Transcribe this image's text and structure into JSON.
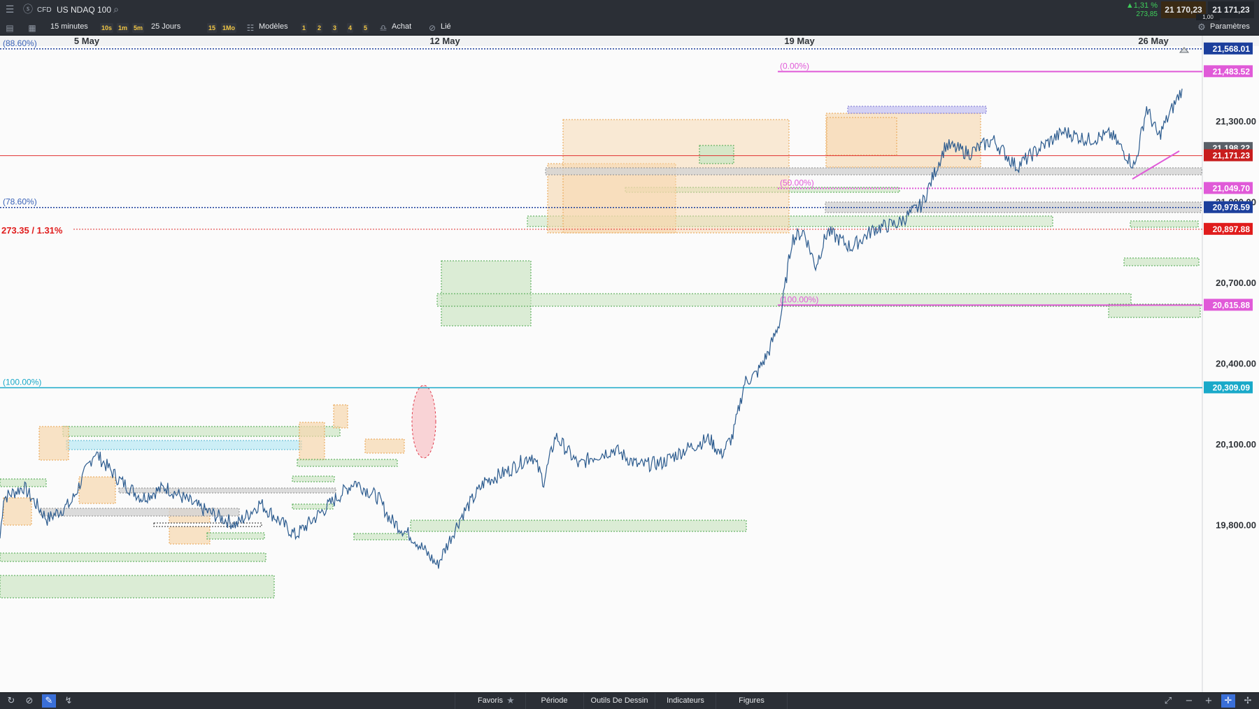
{
  "header": {
    "instrument_type": "CFD",
    "instrument_name": "US NDAQ 100",
    "change_pct": "▲1,31 %",
    "change_abs": "273,85",
    "sell_price": "21 170,23",
    "buy_price": "21 171,23",
    "spread": "1,00"
  },
  "toolbar": {
    "timeframe": "15 minutes",
    "quick_timeframes": [
      "10s",
      "1m",
      "5m"
    ],
    "period": "25 Jours",
    "quick_periods": [
      "15",
      "1Mo"
    ],
    "templates_label": "Modèles",
    "layouts": [
      "1",
      "2",
      "3",
      "4",
      "5"
    ],
    "buy_label": "Achat",
    "linked_label": "Lié",
    "settings_label": "Paramètres"
  },
  "chart_data": {
    "type": "candlestick",
    "instrument": "US NDAQ 100",
    "interval": "15 minutes",
    "x_axis_labels": [
      "5 May",
      "12 May",
      "19 May",
      "26 May"
    ],
    "y_axis_ticks": [
      19800,
      20100,
      20400,
      20700,
      21000,
      21300
    ],
    "y_axis_tick_labels": [
      "19,800.00",
      "20,100.00",
      "20,400.00",
      "20,700.00",
      "21,000.00",
      "21,300.00"
    ],
    "ylim": [
      19542,
      21591
    ],
    "price_tags": [
      {
        "label": "21,568.01",
        "value": 21568.01,
        "color": "#1c3f9c"
      },
      {
        "label": "21,483.52",
        "value": 21483.52,
        "color": "#e05ad8"
      },
      {
        "label": "21,198.22",
        "value": 21198.22,
        "color": "#5a6068"
      },
      {
        "label": "21,171.23",
        "value": 21171.23,
        "color": "#c81d1d"
      },
      {
        "label": "21,049.70",
        "value": 21049.7,
        "color": "#e05ad8"
      },
      {
        "label": "20,978.59",
        "value": 20978.59,
        "color": "#1c3f9c"
      },
      {
        "label": "20,897.88",
        "value": 20897.88,
        "color": "#e01c1c"
      },
      {
        "label": "20,615.88",
        "value": 20615.88,
        "color": "#e05ad8"
      },
      {
        "label": "20,309.09",
        "value": 20309.09,
        "color": "#19a9c9"
      }
    ],
    "fib_levels": [
      {
        "label": "(88.60%)",
        "value": 21568.01,
        "color": "#3a63b8"
      },
      {
        "label": "(78.60%)",
        "value": 20978.59,
        "color": "#3a63b8"
      },
      {
        "label": "(100.00%)",
        "value": 20309.09,
        "color": "#19a9c9"
      },
      {
        "label": "(0.00%)",
        "value": 21483.52,
        "color": "#e05ad8"
      },
      {
        "label": "(50.00%)",
        "value": 21049.7,
        "color": "#e05ad8"
      },
      {
        "label": "(100.00%)",
        "value": 20615.88,
        "color": "#e05ad8"
      }
    ],
    "change_annotation": "273.35 / 1.31%",
    "previous_close": 20897.88,
    "current_price": 21171.23,
    "price_path": [
      [
        0,
        19750
      ],
      [
        0.003,
        19900
      ],
      [
        0.02,
        19940
      ],
      [
        0.04,
        19820
      ],
      [
        0.06,
        19880
      ],
      [
        0.08,
        20070
      ],
      [
        0.1,
        19970
      ],
      [
        0.12,
        19900
      ],
      [
        0.14,
        19940
      ],
      [
        0.17,
        19860
      ],
      [
        0.2,
        19800
      ],
      [
        0.22,
        19880
      ],
      [
        0.25,
        19760
      ],
      [
        0.28,
        19880
      ],
      [
        0.3,
        19960
      ],
      [
        0.32,
        19900
      ],
      [
        0.33,
        19820
      ],
      [
        0.35,
        19750
      ],
      [
        0.37,
        19650
      ],
      [
        0.39,
        19830
      ],
      [
        0.41,
        19960
      ],
      [
        0.43,
        20000
      ],
      [
        0.45,
        20060
      ],
      [
        0.46,
        19960
      ],
      [
        0.47,
        20130
      ],
      [
        0.49,
        20020
      ],
      [
        0.5,
        20050
      ],
      [
        0.52,
        20080
      ],
      [
        0.54,
        20020
      ],
      [
        0.56,
        20030
      ],
      [
        0.58,
        20080
      ],
      [
        0.6,
        20120
      ],
      [
        0.61,
        20060
      ],
      [
        0.62,
        20130
      ],
      [
        0.63,
        20330
      ],
      [
        0.64,
        20360
      ],
      [
        0.65,
        20440
      ],
      [
        0.66,
        20560
      ],
      [
        0.67,
        20860
      ],
      [
        0.68,
        20890
      ],
      [
        0.69,
        20760
      ],
      [
        0.7,
        20890
      ],
      [
        0.72,
        20830
      ],
      [
        0.74,
        20900
      ],
      [
        0.76,
        20920
      ],
      [
        0.78,
        20990
      ],
      [
        0.8,
        21210
      ],
      [
        0.82,
        21180
      ],
      [
        0.84,
        21230
      ],
      [
        0.86,
        21130
      ],
      [
        0.88,
        21200
      ],
      [
        0.9,
        21260
      ],
      [
        0.92,
        21230
      ],
      [
        0.94,
        21250
      ],
      [
        0.96,
        21130
      ],
      [
        0.97,
        21350
      ],
      [
        0.98,
        21240
      ],
      [
        1,
        21420
      ]
    ]
  },
  "bottom_bar": {
    "tabs": [
      "Favoris",
      "Période",
      "Outils De Dessin",
      "Indicateurs",
      "Figures"
    ],
    "favorite_icon": "star-icon"
  }
}
